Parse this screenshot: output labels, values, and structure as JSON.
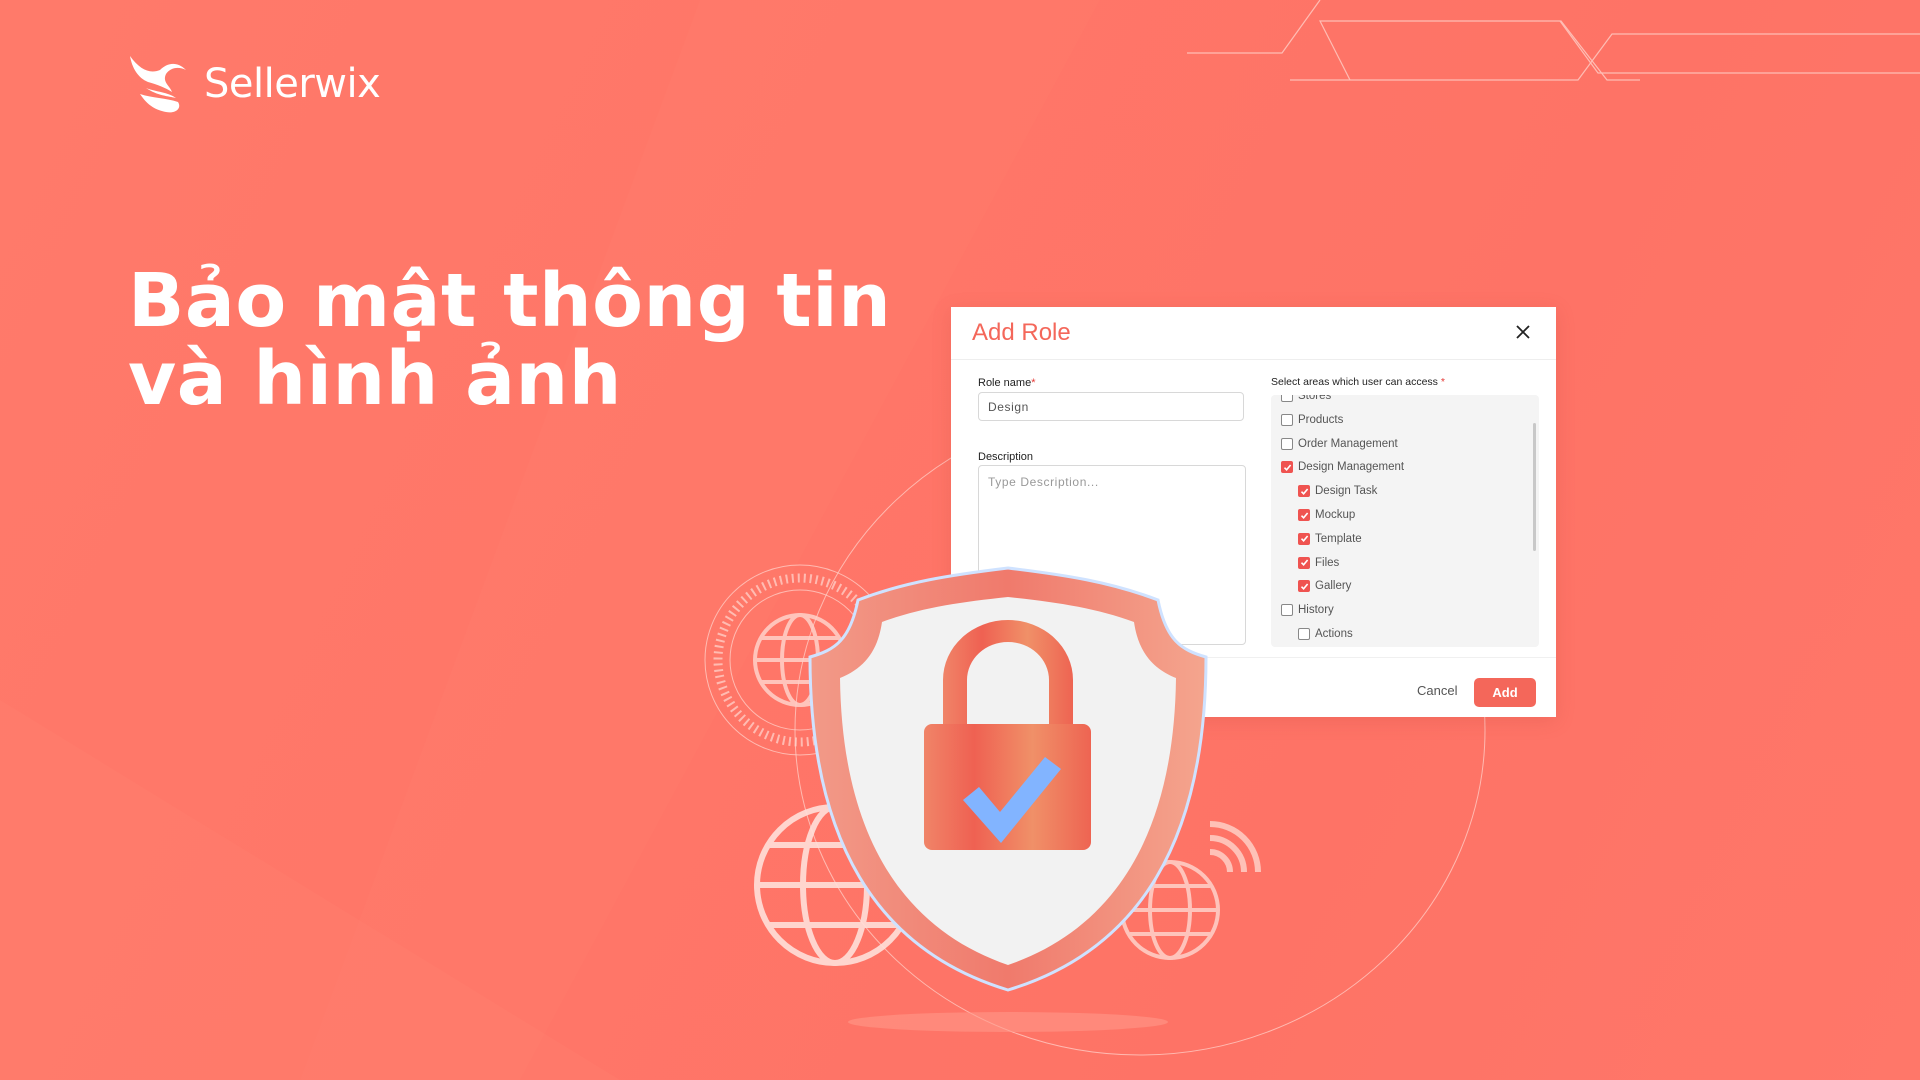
{
  "brand": {
    "name": "Sellerwix",
    "logo_icon": "sellerwix-flame-logo-icon"
  },
  "headline": {
    "line1": "Bảo mật thông tin",
    "line2": "và hình ảnh"
  },
  "colors": {
    "background": "#ff7769",
    "accent": "#f4675a",
    "checkbox_on": "#ef5350",
    "check_mark": "#82b4ff"
  },
  "dialog": {
    "title": "Add Role",
    "close_icon": "close-icon",
    "role_name": {
      "label": "Role name",
      "required_mark": "*",
      "value": "Design"
    },
    "description": {
      "label": "Description",
      "placeholder": "Type Description..."
    },
    "areas": {
      "label": "Select areas which user can access",
      "required_mark": "*",
      "items": [
        {
          "label": "Stores",
          "checked": false,
          "level": 0
        },
        {
          "label": "Products",
          "checked": false,
          "level": 0
        },
        {
          "label": "Order Management",
          "checked": false,
          "level": 0
        },
        {
          "label": "Design Management",
          "checked": true,
          "level": 0
        },
        {
          "label": "Design Task",
          "checked": true,
          "level": 1
        },
        {
          "label": "Mockup",
          "checked": true,
          "level": 1
        },
        {
          "label": "Template",
          "checked": true,
          "level": 1
        },
        {
          "label": "Files",
          "checked": true,
          "level": 1
        },
        {
          "label": "Gallery",
          "checked": true,
          "level": 1
        },
        {
          "label": "History",
          "checked": false,
          "level": 0
        },
        {
          "label": "Actions",
          "checked": false,
          "level": 1
        }
      ]
    },
    "cancel_label": "Cancel",
    "add_label": "Add"
  },
  "illustration": {
    "shield_icon": "shield-icon",
    "lock_icon": "padlock-icon",
    "check_icon": "checkmark-icon",
    "globe_icon": "globe-icon",
    "wifi_icon": "wifi-signal-icon"
  }
}
